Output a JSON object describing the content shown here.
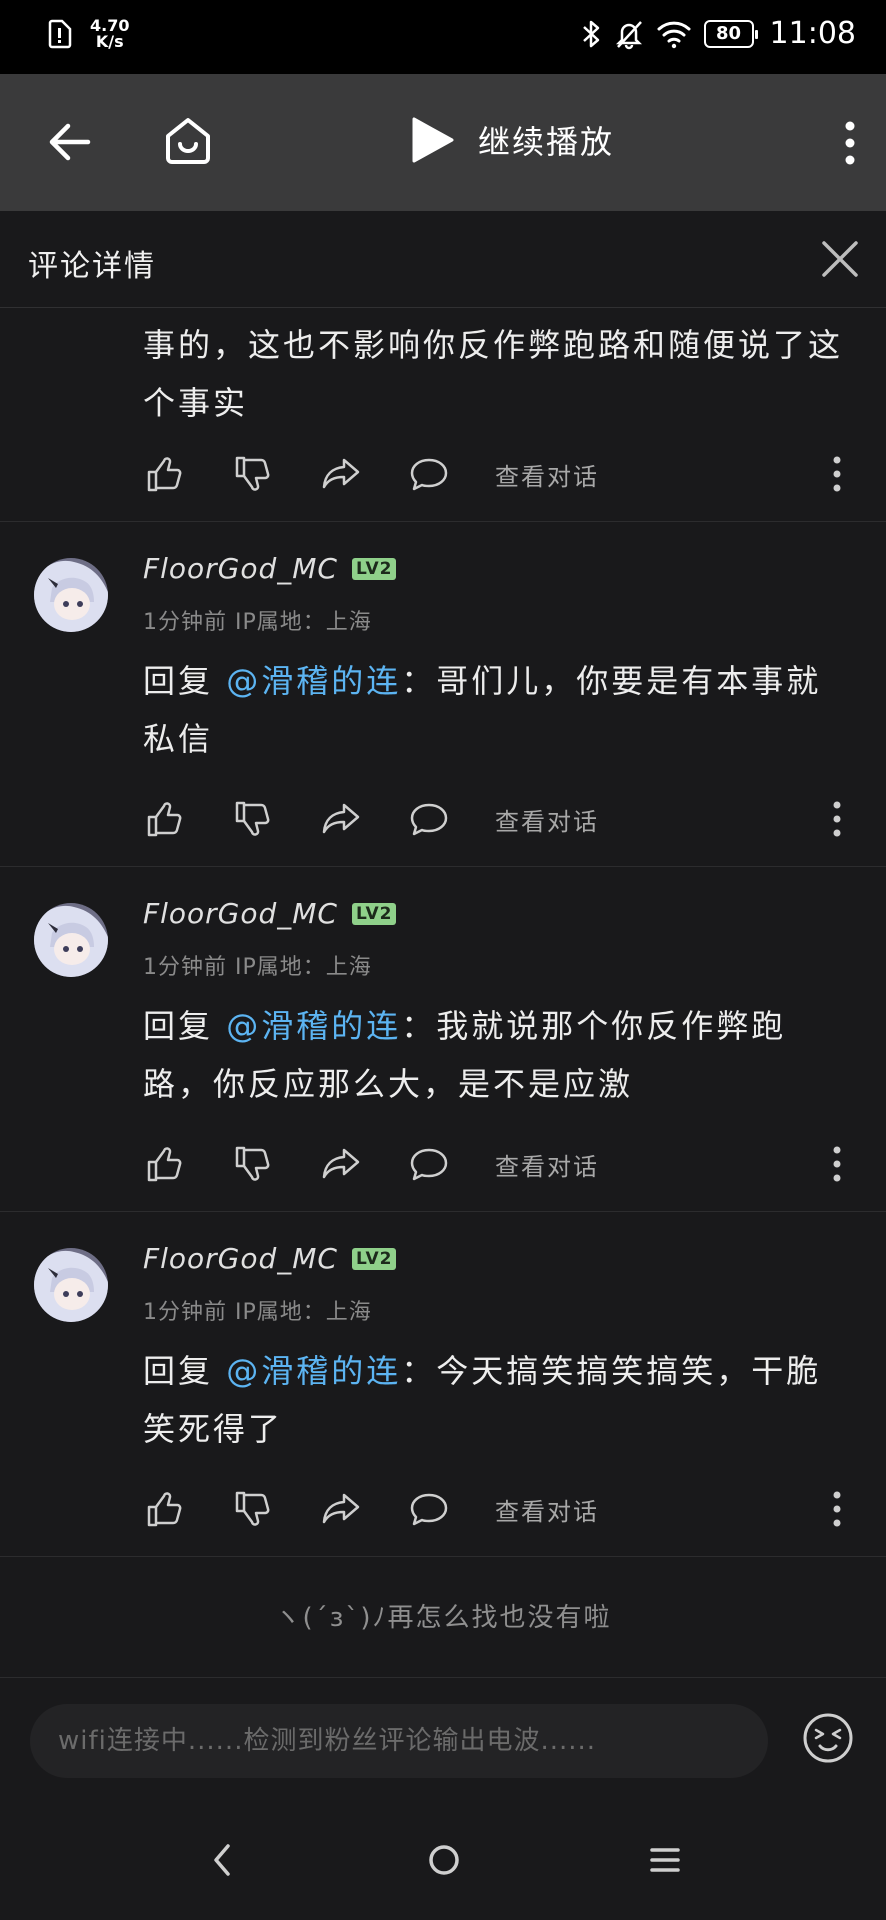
{
  "status_bar": {
    "net_speed_value": "4.70",
    "net_speed_unit": "K/s",
    "battery": "80",
    "time": "11:08"
  },
  "navbar": {
    "back_icon": "arrow-left-icon",
    "home_icon": "home-icon",
    "play_label": "继续播放",
    "more_icon": "more-vertical-icon"
  },
  "panel": {
    "title": "评论详情",
    "close_icon": "close-icon"
  },
  "comments": [
    {
      "text": "事的，这也不影响你反作弊跑路和随便说了这个事实",
      "actions": {
        "view_conversation": "查看对话"
      }
    },
    {
      "username": "FloorGod_MC",
      "level": "LV2",
      "time": "1分钟前",
      "ip": "IP属地：上海",
      "reply_prefix": "回复",
      "mention": "@滑稽的连",
      "text": "：哥们儿，你要是有本事就私信",
      "actions": {
        "view_conversation": "查看对话"
      }
    },
    {
      "username": "FloorGod_MC",
      "level": "LV2",
      "time": "1分钟前",
      "ip": "IP属地：上海",
      "reply_prefix": "回复",
      "mention": "@滑稽的连",
      "text": "：我就说那个你反作弊跑路，你反应那么大，是不是应激",
      "actions": {
        "view_conversation": "查看对话"
      }
    },
    {
      "username": "FloorGod_MC",
      "level": "LV2",
      "time": "1分钟前",
      "ip": "IP属地：上海",
      "reply_prefix": "回复",
      "mention": "@滑稽的连",
      "text": "：今天搞笑搞笑搞笑，干脆笑死得了",
      "actions": {
        "view_conversation": "查看对话"
      }
    }
  ],
  "end_note": "ヽ(´з`)ﾉ再怎么找也没有啦",
  "composer": {
    "placeholder": "wifi连接中......检测到粉丝评论输出电波......",
    "emoji_icon": "emoji-face-icon"
  },
  "system_nav": {
    "back": "nav-back-icon",
    "home": "nav-home-icon",
    "menu": "nav-menu-icon"
  },
  "colors": {
    "background": "#19191b",
    "navbar": "#3a3a3b",
    "mention": "#5cb4f2",
    "level_badge": "#8fd08a"
  }
}
